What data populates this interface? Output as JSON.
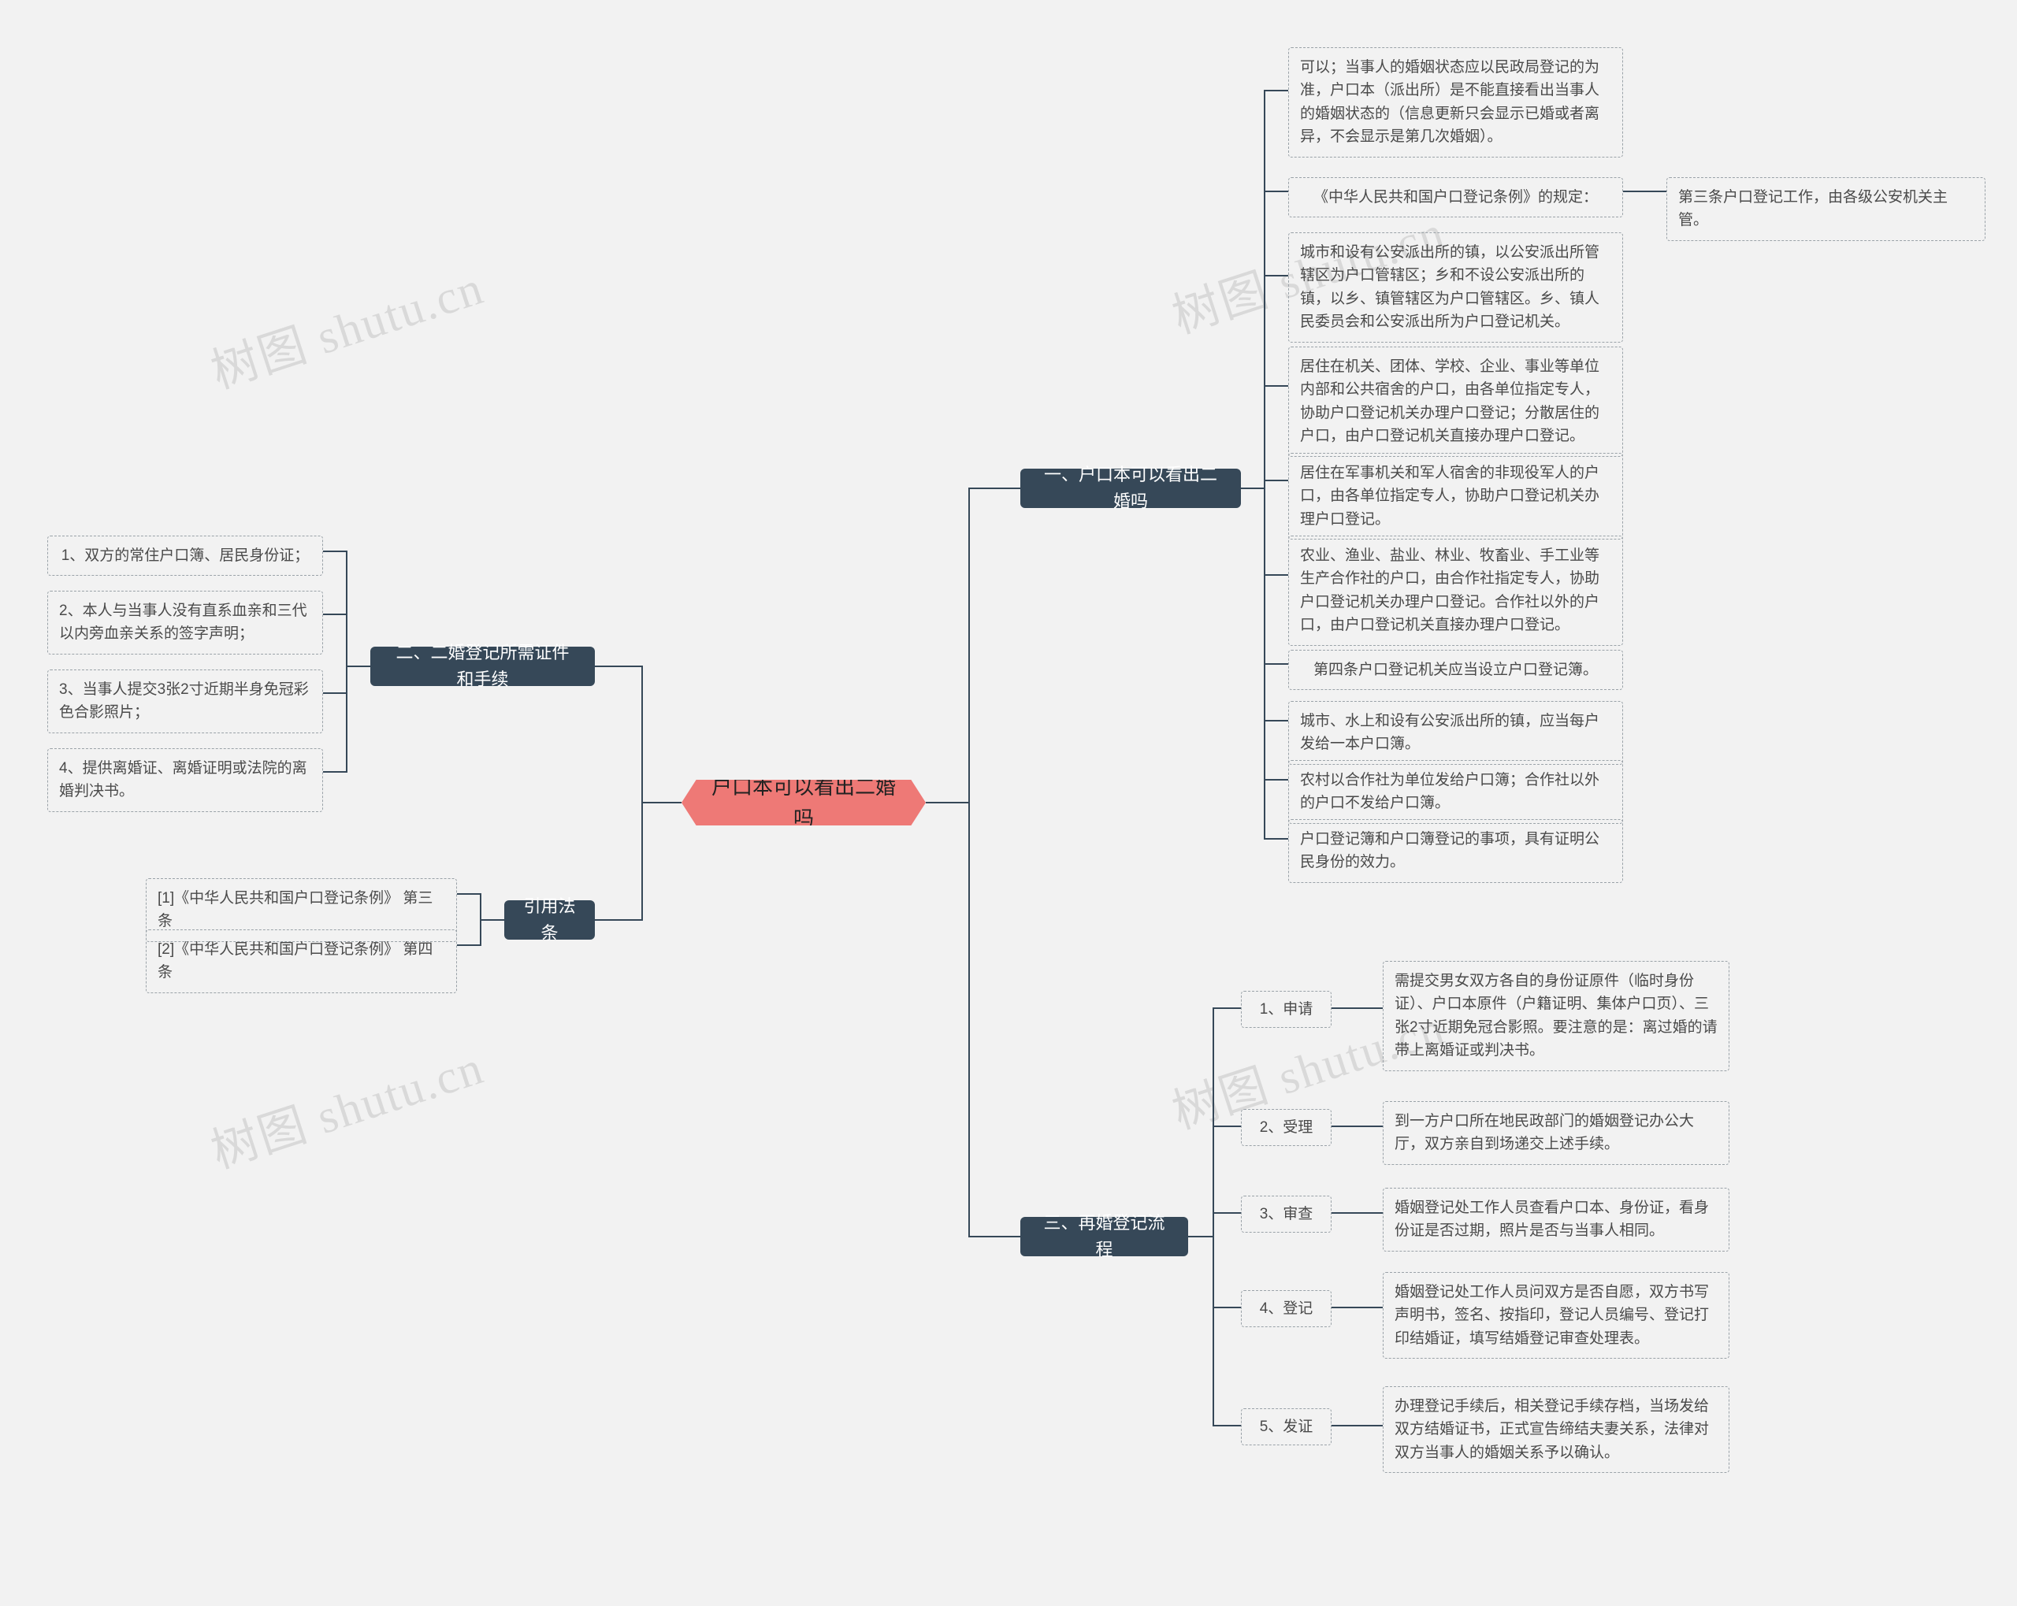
{
  "root": "户口本可以看出二婚吗",
  "branch1": {
    "title": "一、户口本可以看出二婚吗",
    "leaves": [
      "可以；当事人的婚姻状态应以民政局登记的为准，户口本（派出所）是不能直接看出当事人的婚姻状态的（信息更新只会显示已婚或者离异，不会显示是第几次婚姻）。",
      "《中华人民共和国户口登记条例》的规定：",
      "城市和设有公安派出所的镇，以公安派出所管辖区为户口管辖区；乡和不设公安派出所的镇，以乡、镇管辖区为户口管辖区。乡、镇人民委员会和公安派出所为户口登记机关。",
      "居住在机关、团体、学校、企业、事业等单位内部和公共宿舍的户口，由各单位指定专人，协助户口登记机关办理户口登记；分散居住的户口，由户口登记机关直接办理户口登记。",
      "居住在军事机关和军人宿舍的非现役军人的户口，由各单位指定专人，协助户口登记机关办理户口登记。",
      "农业、渔业、盐业、林业、牧畜业、手工业等生产合作社的户口，由合作社指定专人，协助户口登记机关办理户口登记。合作社以外的户口，由户口登记机关直接办理户口登记。",
      "第四条户口登记机关应当设立户口登记簿。",
      "城市、水上和设有公安派出所的镇，应当每户发给一本户口簿。",
      "农村以合作社为单位发给户口簿；合作社以外的户口不发给户口簿。",
      "户口登记簿和户口簿登记的事项，具有证明公民身份的效力。"
    ],
    "leaf2_sub": "第三条户口登记工作，由各级公安机关主管。"
  },
  "branch2": {
    "title": "二、二婚登记所需证件和手续",
    "leaves": [
      "1、双方的常住户口簿、居民身份证；",
      "2、本人与当事人没有直系血亲和三代以内旁血亲关系的签字声明；",
      "3、当事人提交3张2寸近期半身免冠彩色合影照片；",
      "4、提供离婚证、离婚证明或法院的离婚判决书。"
    ]
  },
  "branch3": {
    "title": "三、再婚登记流程",
    "steps": [
      "1、申请",
      "2、受理",
      "3、审查",
      "4、登记",
      "5、发证"
    ],
    "details": [
      "需提交男女双方各自的身份证原件（临时身份证）、户口本原件（户籍证明、集体户口页）、三张2寸近期免冠合影照。要注意的是：离过婚的请带上离婚证或判决书。",
      "到一方户口所在地民政部门的婚姻登记办公大厅，双方亲自到场递交上述手续。",
      "婚姻登记处工作人员查看户口本、身份证，看身份证是否过期，照片是否与当事人相同。",
      "婚姻登记处工作人员问双方是否自愿，双方书写声明书，签名、按指印，登记人员编号、登记打印结婚证，填写结婚登记审查处理表。",
      "办理登记手续后，相关登记手续存档，当场发给双方结婚证书，正式宣告缔结夫妻关系，法律对双方当事人的婚姻关系予以确认。"
    ]
  },
  "branch4": {
    "title": "引用法条",
    "leaves": [
      "[1]《中华人民共和国户口登记条例》 第三条",
      "[2]《中华人民共和国户口登记条例》 第四条"
    ]
  },
  "watermark": "树图 shutu.cn"
}
